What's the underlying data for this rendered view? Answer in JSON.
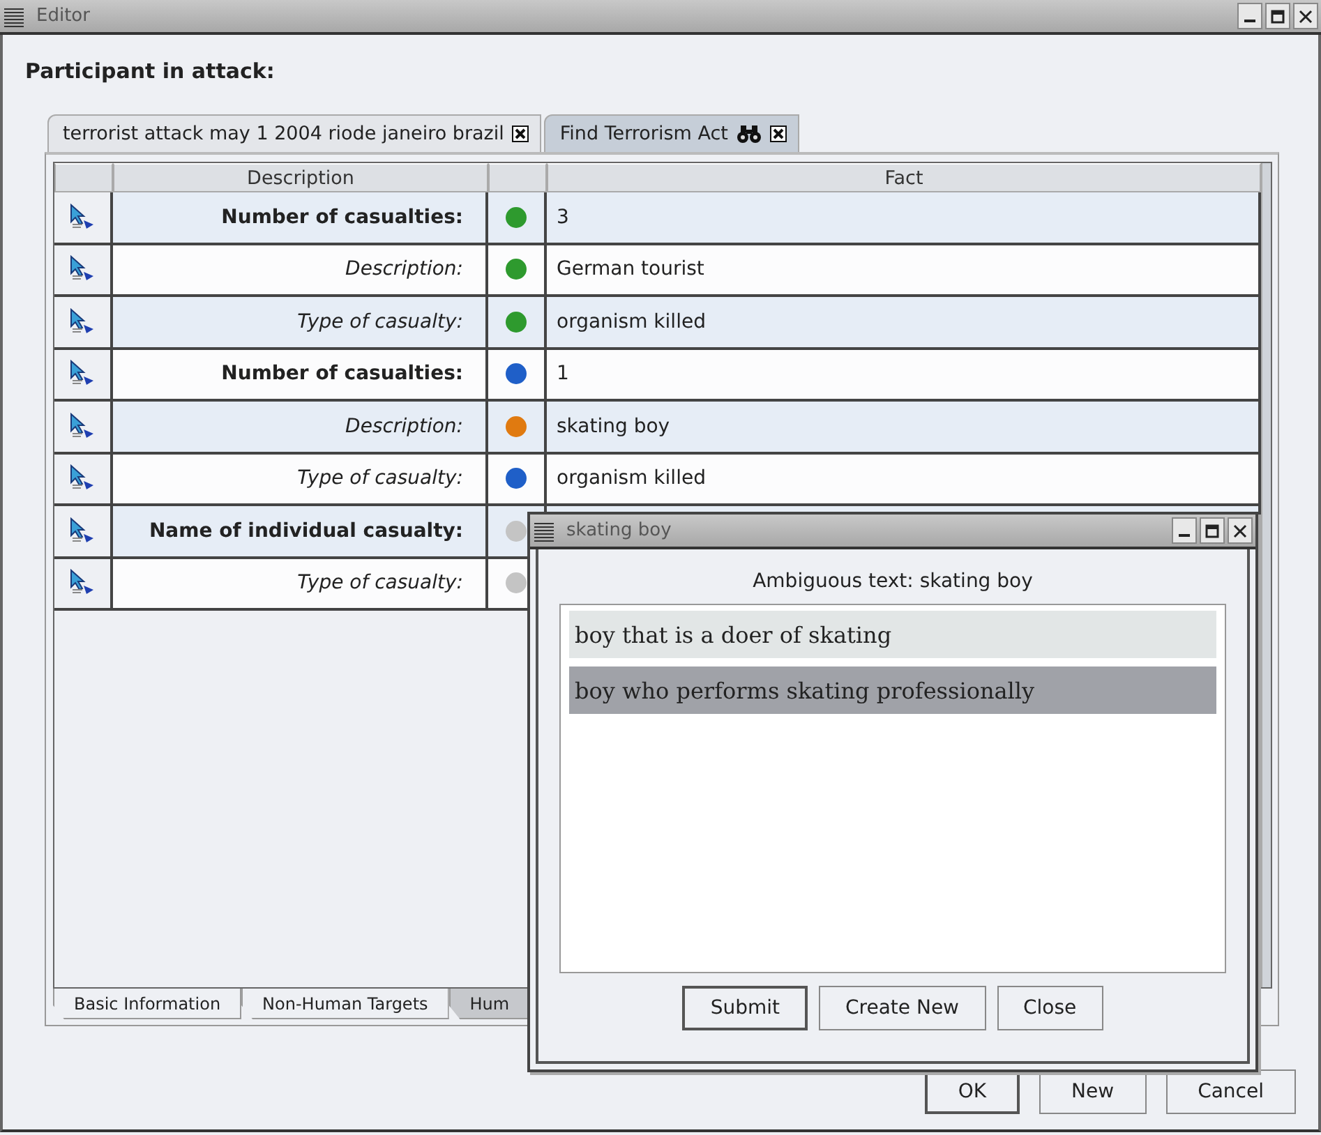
{
  "window": {
    "title": "Editor",
    "heading": "Participant in attack:"
  },
  "tabs": [
    {
      "label": "terrorist attack may 1 2004 riode janeiro brazil",
      "selected": true,
      "kind": "plain"
    },
    {
      "label": "Find Terrorism Act",
      "selected": false,
      "kind": "search"
    }
  ],
  "table": {
    "columns": [
      "Description",
      "Fact"
    ],
    "rows": [
      {
        "label": "Number of casualties:",
        "kind": "bold",
        "color": "#2e9a2e",
        "fact": "3"
      },
      {
        "label": "Description:",
        "kind": "italic",
        "color": "#2e9a2e",
        "fact": "German tourist"
      },
      {
        "label": "Type of casualty:",
        "kind": "italic",
        "color": "#2e9a2e",
        "fact": "organism killed"
      },
      {
        "label": "Number of casualties:",
        "kind": "bold",
        "color": "#1f5fc8",
        "fact": "1"
      },
      {
        "label": "Description:",
        "kind": "italic",
        "color": "#e07a10",
        "fact": "skating boy"
      },
      {
        "label": "Type of casualty:",
        "kind": "italic",
        "color": "#1f5fc8",
        "fact": "organism killed"
      },
      {
        "label": "Name of individual casualty:",
        "kind": "bold",
        "color": "#c4c4c4"
      },
      {
        "label": "Type of casualty:",
        "kind": "italic",
        "color": "#c4c4c4"
      }
    ]
  },
  "bottom_tabs": [
    {
      "label": "Basic Information",
      "selected": false
    },
    {
      "label": "Non-Human Targets",
      "selected": false
    },
    {
      "label": "Hum",
      "selected": true
    }
  ],
  "buttons": [
    "OK",
    "New",
    "Cancel"
  ],
  "dialog": {
    "title": "skating boy",
    "prompt": "Ambiguous text:  skating boy",
    "options": [
      {
        "label": "boy that is a doer of skating",
        "selected": false
      },
      {
        "label": "boy who performs skating professionally",
        "selected": true
      }
    ],
    "buttons": [
      "Submit",
      "Create New",
      "Close"
    ]
  }
}
